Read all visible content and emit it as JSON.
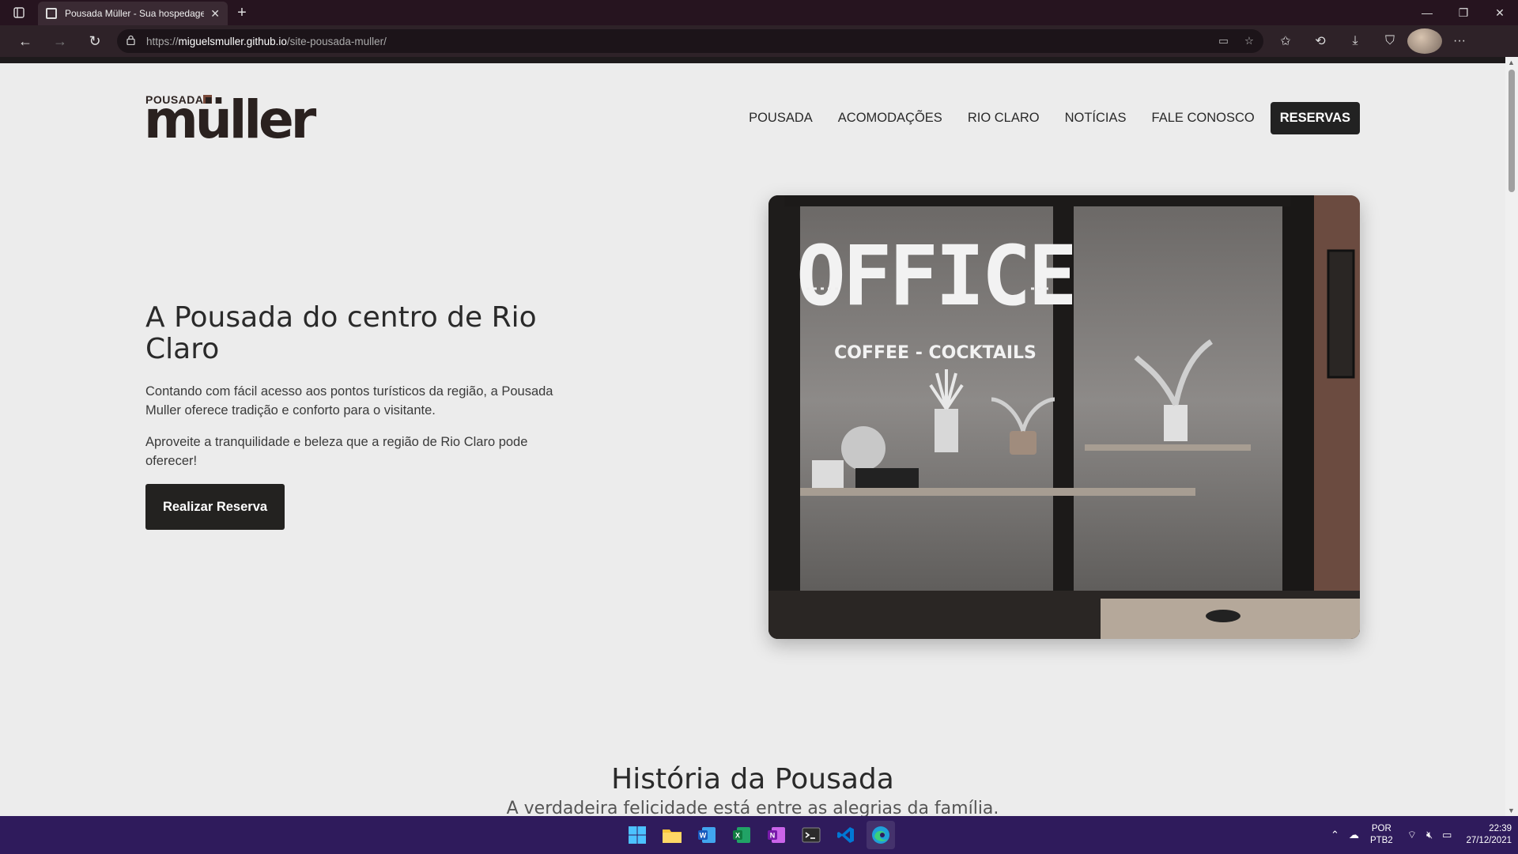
{
  "browser": {
    "tab_title": "Pousada Müller - Sua hospedagem",
    "url_scheme": "https://",
    "url_host": "miguelsmuller.github.io",
    "url_path": "/site-pousada-muller/"
  },
  "site": {
    "logo_small": "POUSADA",
    "logo_big": "müller",
    "nav": [
      "POUSADA",
      "ACOMODAÇÕES",
      "RIO CLARO",
      "NOTÍCIAS",
      "FALE CONOSCO"
    ],
    "nav_cta": "RESERVAS",
    "hero": {
      "title": "A Pousada do centro de Rio Claro",
      "p1": "Contando com fácil acesso aos pontos turísticos da região, a Pousada Muller oferece tradição e conforto para o visitante.",
      "p2": "Aproveite a tranquilidade e beleza que a região de Rio Claro pode oferecer!",
      "button": "Realizar Reserva",
      "image_sign_main": "OFFICE",
      "image_sign_sub": "COFFEE - COCKTAILS"
    },
    "history": {
      "title": "História da Pousada",
      "subtitle": "A verdadeira felicidade está entre as alegrias da família."
    }
  },
  "taskbar": {
    "apps": [
      "start-icon",
      "file-explorer-icon",
      "word-icon",
      "excel-icon",
      "onenote-icon",
      "terminal-icon",
      "vscode-icon",
      "edge-icon"
    ],
    "lang_top": "POR",
    "lang_bottom": "PTB2",
    "time": "22:39",
    "date": "27/12/2021"
  }
}
